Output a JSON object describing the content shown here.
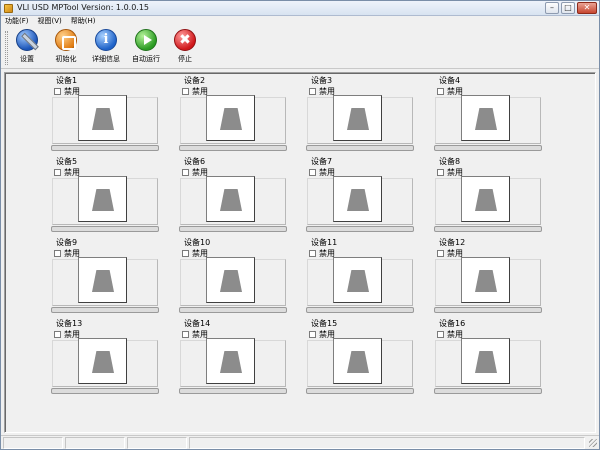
{
  "window": {
    "title": "VLI USD MPTool   Version: 1.0.0.15",
    "buttons": {
      "minimize": "–",
      "maximize": "□",
      "close": "✕"
    }
  },
  "menubar": {
    "items": [
      {
        "label": "功能(F)"
      },
      {
        "label": "视图(V)"
      },
      {
        "label": "帮助(H)"
      }
    ]
  },
  "toolbar": {
    "buttons": [
      {
        "label": "设置",
        "icon": "settings-icon"
      },
      {
        "label": "初始化",
        "icon": "initialize-icon"
      },
      {
        "label": "详细信息",
        "icon": "info-icon",
        "glyph": "i"
      },
      {
        "label": "自动运行",
        "icon": "play-icon"
      },
      {
        "label": "停止",
        "icon": "stop-icon",
        "glyph": "✖"
      }
    ]
  },
  "devices": [
    {
      "label": "设备1",
      "disable_label": "禁用",
      "disabled": false,
      "progress": 0
    },
    {
      "label": "设备2",
      "disable_label": "禁用",
      "disabled": false,
      "progress": 0
    },
    {
      "label": "设备3",
      "disable_label": "禁用",
      "disabled": false,
      "progress": 0
    },
    {
      "label": "设备4",
      "disable_label": "禁用",
      "disabled": false,
      "progress": 0
    },
    {
      "label": "设备5",
      "disable_label": "禁用",
      "disabled": false,
      "progress": 0
    },
    {
      "label": "设备6",
      "disable_label": "禁用",
      "disabled": false,
      "progress": 0
    },
    {
      "label": "设备7",
      "disable_label": "禁用",
      "disabled": false,
      "progress": 0
    },
    {
      "label": "设备8",
      "disable_label": "禁用",
      "disabled": false,
      "progress": 0
    },
    {
      "label": "设备9",
      "disable_label": "禁用",
      "disabled": false,
      "progress": 0
    },
    {
      "label": "设备10",
      "disable_label": "禁用",
      "disabled": false,
      "progress": 0
    },
    {
      "label": "设备11",
      "disable_label": "禁用",
      "disabled": false,
      "progress": 0
    },
    {
      "label": "设备12",
      "disable_label": "禁用",
      "disabled": false,
      "progress": 0
    },
    {
      "label": "设备13",
      "disable_label": "禁用",
      "disabled": false,
      "progress": 0
    },
    {
      "label": "设备14",
      "disable_label": "禁用",
      "disabled": false,
      "progress": 0
    },
    {
      "label": "设备15",
      "disable_label": "禁用",
      "disabled": false,
      "progress": 0
    },
    {
      "label": "设备16",
      "disable_label": "禁用",
      "disabled": false,
      "progress": 0
    }
  ],
  "colors": {
    "window_bg": "#f0f0f0",
    "drive_icon": "#8c8c8c",
    "progress_fill": "#3cb043"
  }
}
